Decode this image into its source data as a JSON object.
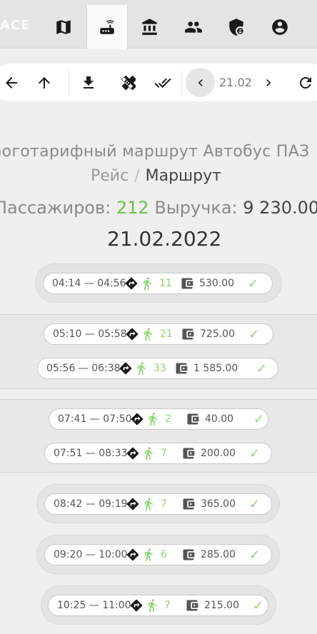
{
  "nav": {
    "logo_text": "ACE",
    "tabs": [
      {
        "name": "map",
        "icon": "map-icon"
      },
      {
        "name": "router",
        "icon": "router-icon",
        "active": true
      },
      {
        "name": "bank",
        "icon": "bank-icon"
      },
      {
        "name": "people",
        "icon": "people-icon"
      },
      {
        "name": "security",
        "icon": "shield-account-icon"
      },
      {
        "name": "account",
        "icon": "account-circle-icon"
      }
    ]
  },
  "toolbar": {
    "date": "21.02",
    "icons": [
      "arrow-left-icon",
      "arrow-up-icon",
      "download-icon",
      "bandage-icon",
      "double-check-icon",
      "chevron-left-icon",
      "chevron-right-icon",
      "refresh-icon"
    ]
  },
  "header": {
    "title": "ноготарифный маршрут Автобус ПАЗ",
    "crumb_1": "Рейс",
    "crumb_sep": "/",
    "crumb_2": "Маршрут",
    "passengers_label": "Пассажиров:",
    "passengers_value": "212",
    "revenue_label": "Выручка:",
    "revenue_value": "9 230.00",
    "date": "21.02.2022"
  },
  "groups": [
    {
      "trips": [
        {
          "time": "04:14 — 04:56",
          "passengers": "11",
          "sum": "530.00"
        }
      ]
    },
    {
      "trips": [
        {
          "time": "05:10 — 05:58",
          "passengers": "21",
          "sum": "725.00"
        },
        {
          "time": "05:56 — 06:38",
          "passengers": "33",
          "sum": "1 585.00"
        }
      ]
    },
    {
      "trips": [
        {
          "time": "07:41 — 07:50",
          "passengers": "2",
          "sum": "40.00"
        },
        {
          "time": "07:51 — 08:33",
          "passengers": "7",
          "sum": "200.00"
        }
      ]
    },
    {
      "trips": [
        {
          "time": "08:42 — 09:19",
          "passengers": "7",
          "sum": "365.00"
        }
      ]
    },
    {
      "trips": [
        {
          "time": "09:20 — 10:00",
          "passengers": "6",
          "sum": "285.00"
        }
      ]
    },
    {
      "trips": [
        {
          "time": "10:25 — 11:00",
          "passengers": "7",
          "sum": "215.00"
        }
      ]
    }
  ],
  "colors": {
    "accent_green": "#6cc04a",
    "check_green": "#8bd66e"
  }
}
